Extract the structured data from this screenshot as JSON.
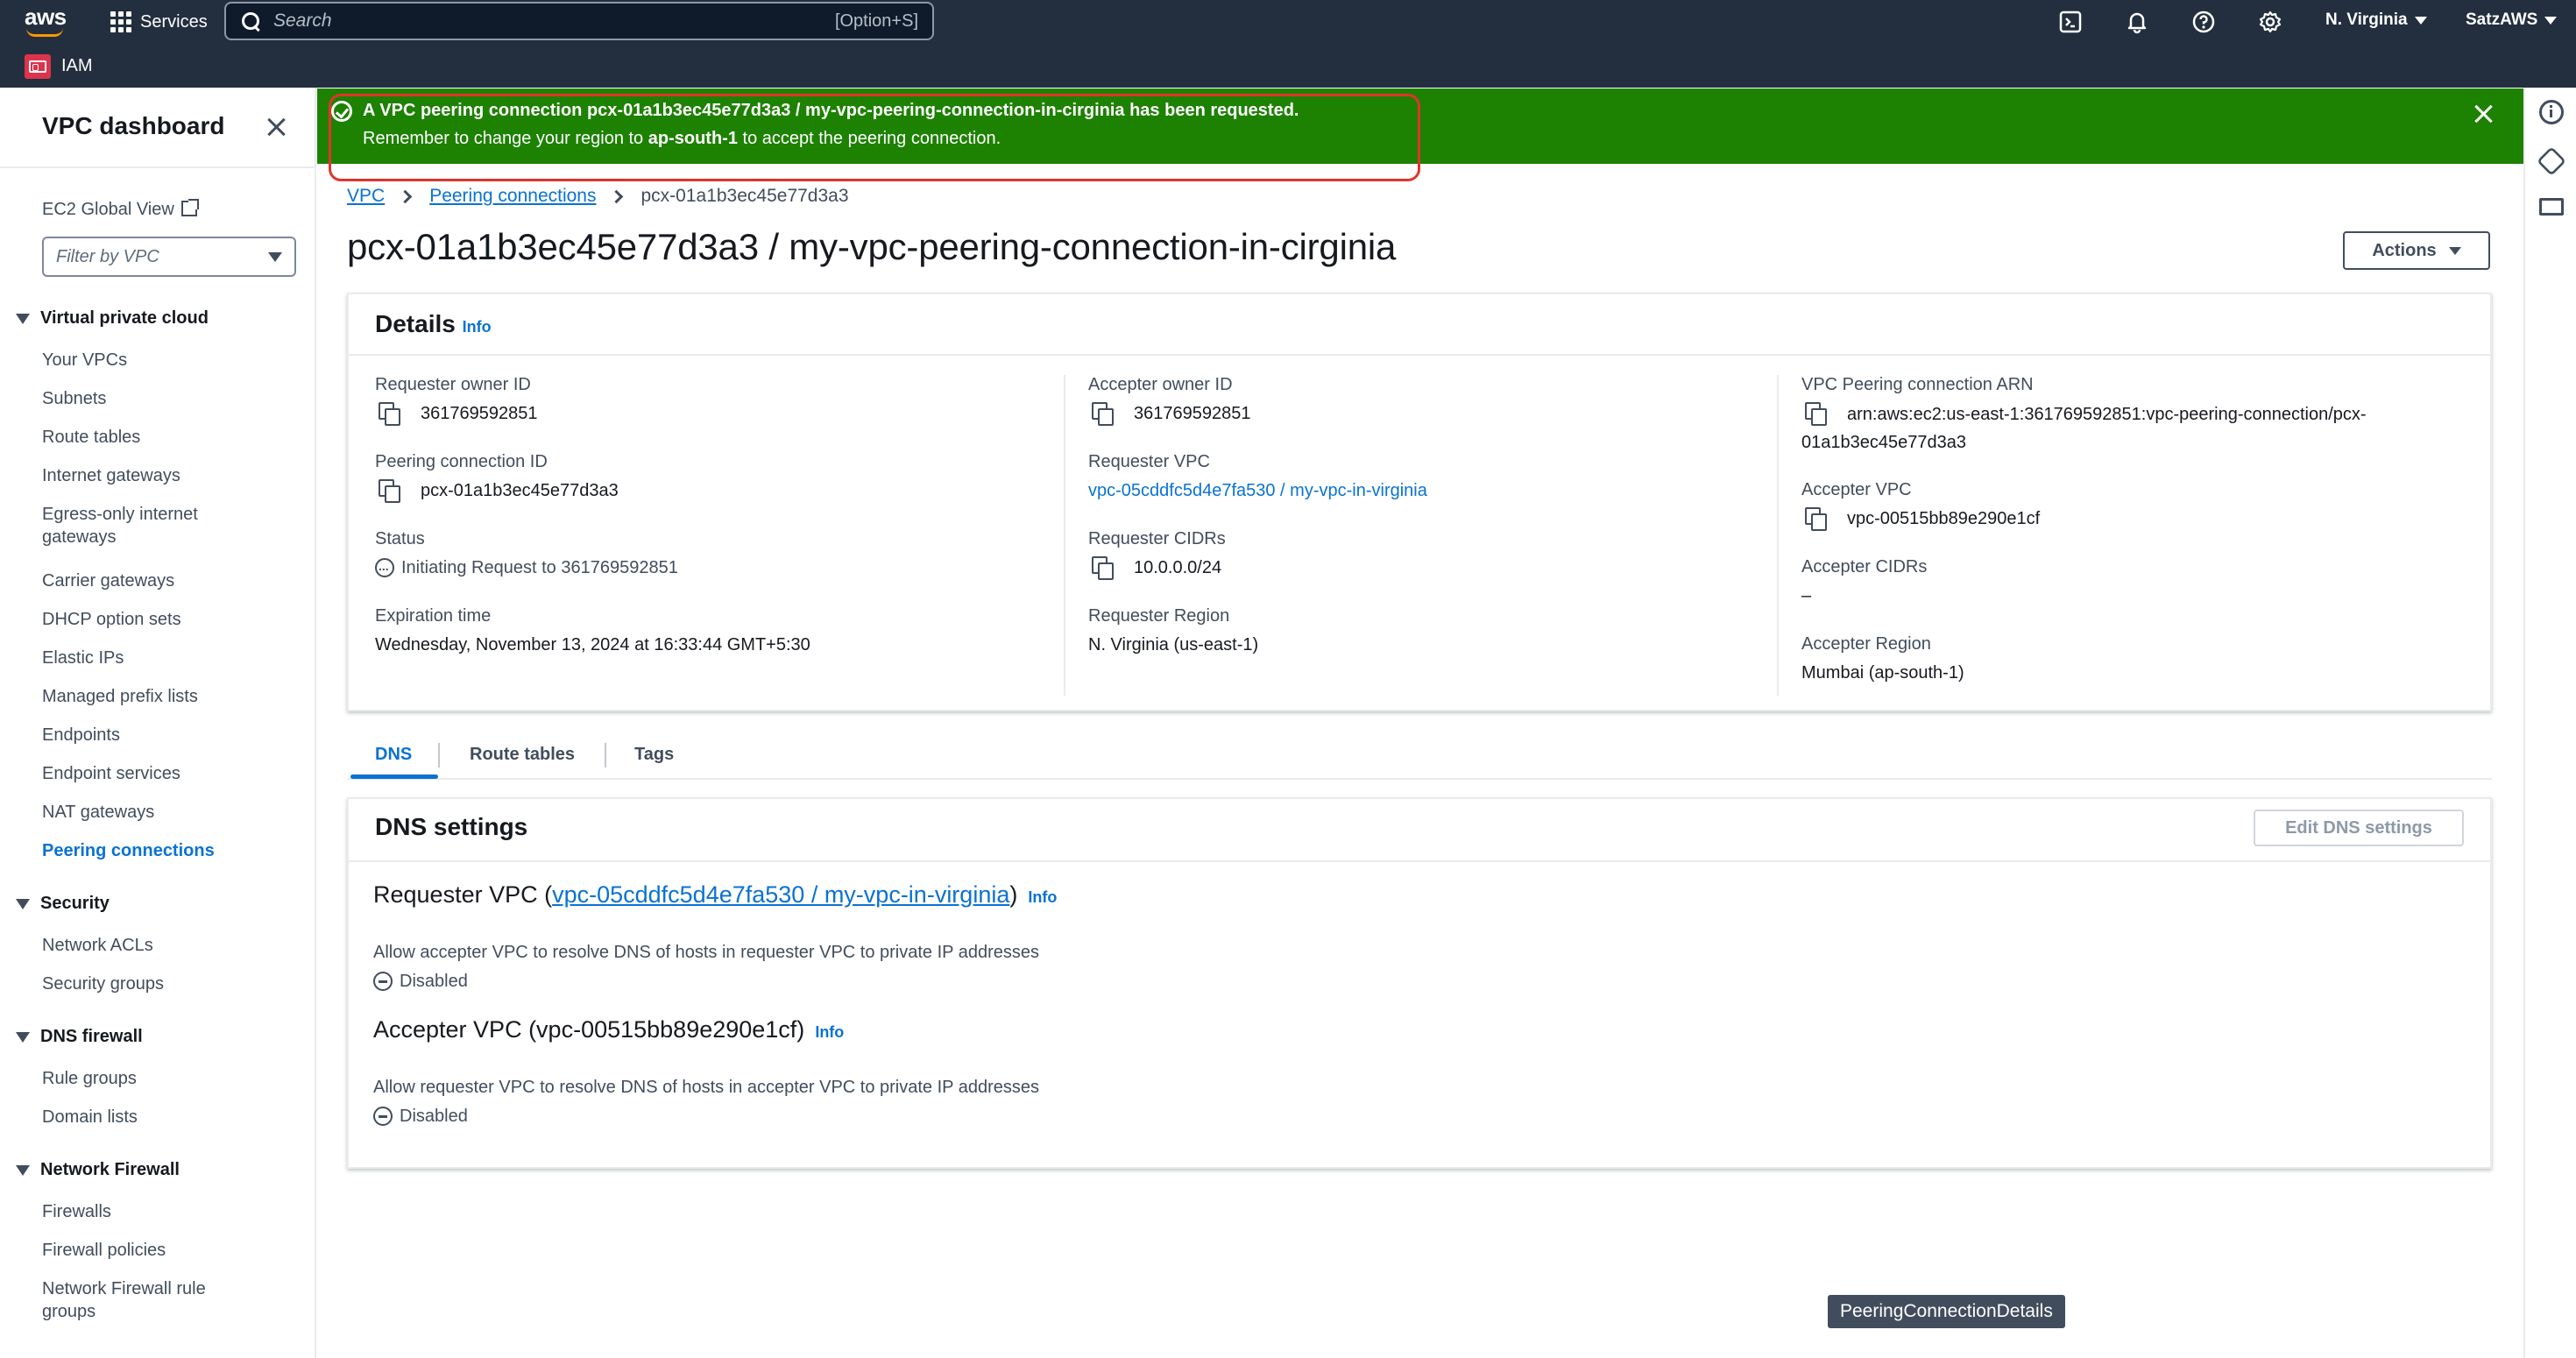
{
  "topnav": {
    "logo_text": "aws",
    "services_label": "Services",
    "search_placeholder": "Search",
    "search_shortcut": "[Option+S]",
    "region": "N. Virginia",
    "account": "SatzAWS"
  },
  "subnav": {
    "favorite_label": "IAM"
  },
  "sidebar": {
    "title": "VPC dashboard",
    "ec2_global_view": "EC2 Global View",
    "filter_placeholder": "Filter by VPC",
    "sections": [
      {
        "title": "Virtual private cloud",
        "items": [
          "Your VPCs",
          "Subnets",
          "Route tables",
          "Internet gateways",
          "Egress-only internet",
          "gateways",
          "Carrier gateways",
          "DHCP option sets",
          "Elastic IPs",
          "Managed prefix lists",
          "Endpoints",
          "Endpoint services",
          "NAT gateways",
          "Peering connections"
        ]
      },
      {
        "title": "Security",
        "items": [
          "Network ACLs",
          "Security groups"
        ]
      },
      {
        "title": "DNS firewall",
        "items": [
          "Rule groups",
          "Domain lists"
        ]
      },
      {
        "title": "Network Firewall",
        "items": [
          "Firewalls",
          "Firewall policies",
          "Network Firewall rule",
          "groups"
        ]
      }
    ],
    "active_item": "Peering connections"
  },
  "flash": {
    "line1_prefix": "A VPC peering connection ",
    "line1_name": "pcx-01a1b3ec45e77d3a3 / my-vpc-peering-connection-in-cirginia",
    "line1_suffix": " has been requested.",
    "line2_prefix": "Remember to change your region to ",
    "line2_region": "ap-south-1",
    "line2_suffix": " to accept the peering connection.",
    "color": "#1d8102"
  },
  "breadcrumb": {
    "root": "VPC",
    "parent": "Peering connections",
    "current": "pcx-01a1b3ec45e77d3a3"
  },
  "page_title": "pcx-01a1b3ec45e77d3a3 / my-vpc-peering-connection-in-cirginia",
  "actions_label": "Actions",
  "details": {
    "title": "Details",
    "info": "Info",
    "col1": {
      "requester_owner_id_label": "Requester owner ID",
      "requester_owner_id": "361769592851",
      "peering_id_label": "Peering connection ID",
      "peering_id": "pcx-01a1b3ec45e77d3a3",
      "status_label": "Status",
      "status": "Initiating Request to 361769592851",
      "expiration_label": "Expiration time",
      "expiration": "Wednesday, November 13, 2024 at 16:33:44 GMT+5:30"
    },
    "col2": {
      "accepter_owner_id_label": "Accepter owner ID",
      "accepter_owner_id": "361769592851",
      "requester_vpc_label": "Requester VPC",
      "requester_vpc": "vpc-05cddfc5d4e7fa530 / my-vpc-in-virginia",
      "requester_cidrs_label": "Requester CIDRs",
      "requester_cidrs": "10.0.0.0/24",
      "requester_region_label": "Requester Region",
      "requester_region": "N. Virginia (us-east-1)"
    },
    "col3": {
      "arn_label": "VPC Peering connection ARN",
      "arn_line1": "arn:aws:ec2:us-east-1:361769592851:vpc-peering-connection/pcx-",
      "arn_line2": "01a1b3ec45e77d3a3",
      "accepter_vpc_label": "Accepter VPC",
      "accepter_vpc": "vpc-00515bb89e290e1cf",
      "accepter_cidrs_label": "Accepter CIDRs",
      "accepter_cidrs": "–",
      "accepter_region_label": "Accepter Region",
      "accepter_region": "Mumbai (ap-south-1)"
    }
  },
  "tabs": [
    "DNS",
    "Route tables",
    "Tags"
  ],
  "dns": {
    "title": "DNS settings",
    "edit_label": "Edit DNS settings",
    "requester_prefix": "Requester VPC (",
    "requester_vpc_link": "vpc-05cddfc5d4e7fa530 / my-vpc-in-virginia",
    "requester_suffix": ")",
    "info": "Info",
    "requester_desc": "Allow accepter VPC to resolve DNS of hosts in requester VPC to private IP addresses",
    "requester_status": "Disabled",
    "accepter_title": "Accepter VPC (vpc-00515bb89e290e1cf)",
    "accepter_desc": "Allow requester VPC to resolve DNS of hosts in accepter VPC to private IP addresses",
    "accepter_status": "Disabled"
  },
  "tooltip": "PeeringConnectionDetails"
}
